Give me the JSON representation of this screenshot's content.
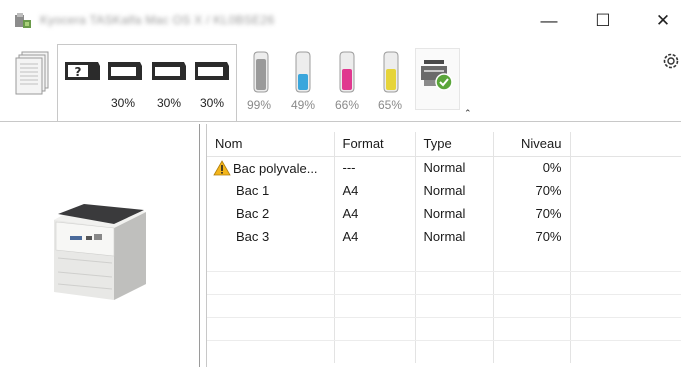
{
  "window": {
    "title": "Kyocera TASKalfa Mac OS X / KL0BSE26",
    "controls": {
      "minimize": "—",
      "maximize": "☐",
      "close": "✕"
    }
  },
  "toolbar": {
    "paper_percents": [
      "30%",
      "30%",
      "30%"
    ],
    "toner_percents": [
      "99%",
      "49%",
      "66%",
      "65%"
    ],
    "toner_colors": [
      "#9a9a9a",
      "#3aa6dc",
      "#e0388f",
      "#e6d43a"
    ],
    "collapse_glyph": "⌃"
  },
  "table": {
    "headers": {
      "nom": "Nom",
      "format": "Format",
      "type": "Type",
      "niveau": "Niveau"
    },
    "rows": [
      {
        "nom": "Bac polyvale...",
        "format": "---",
        "type": "Normal",
        "niveau": "0%",
        "warning": true
      },
      {
        "nom": "Bac 1",
        "format": "A4",
        "type": "Normal",
        "niveau": "70%",
        "warning": false
      },
      {
        "nom": "Bac 2",
        "format": "A4",
        "type": "Normal",
        "niveau": "70%",
        "warning": false
      },
      {
        "nom": "Bac 3",
        "format": "A4",
        "type": "Normal",
        "niveau": "70%",
        "warning": false
      }
    ]
  }
}
